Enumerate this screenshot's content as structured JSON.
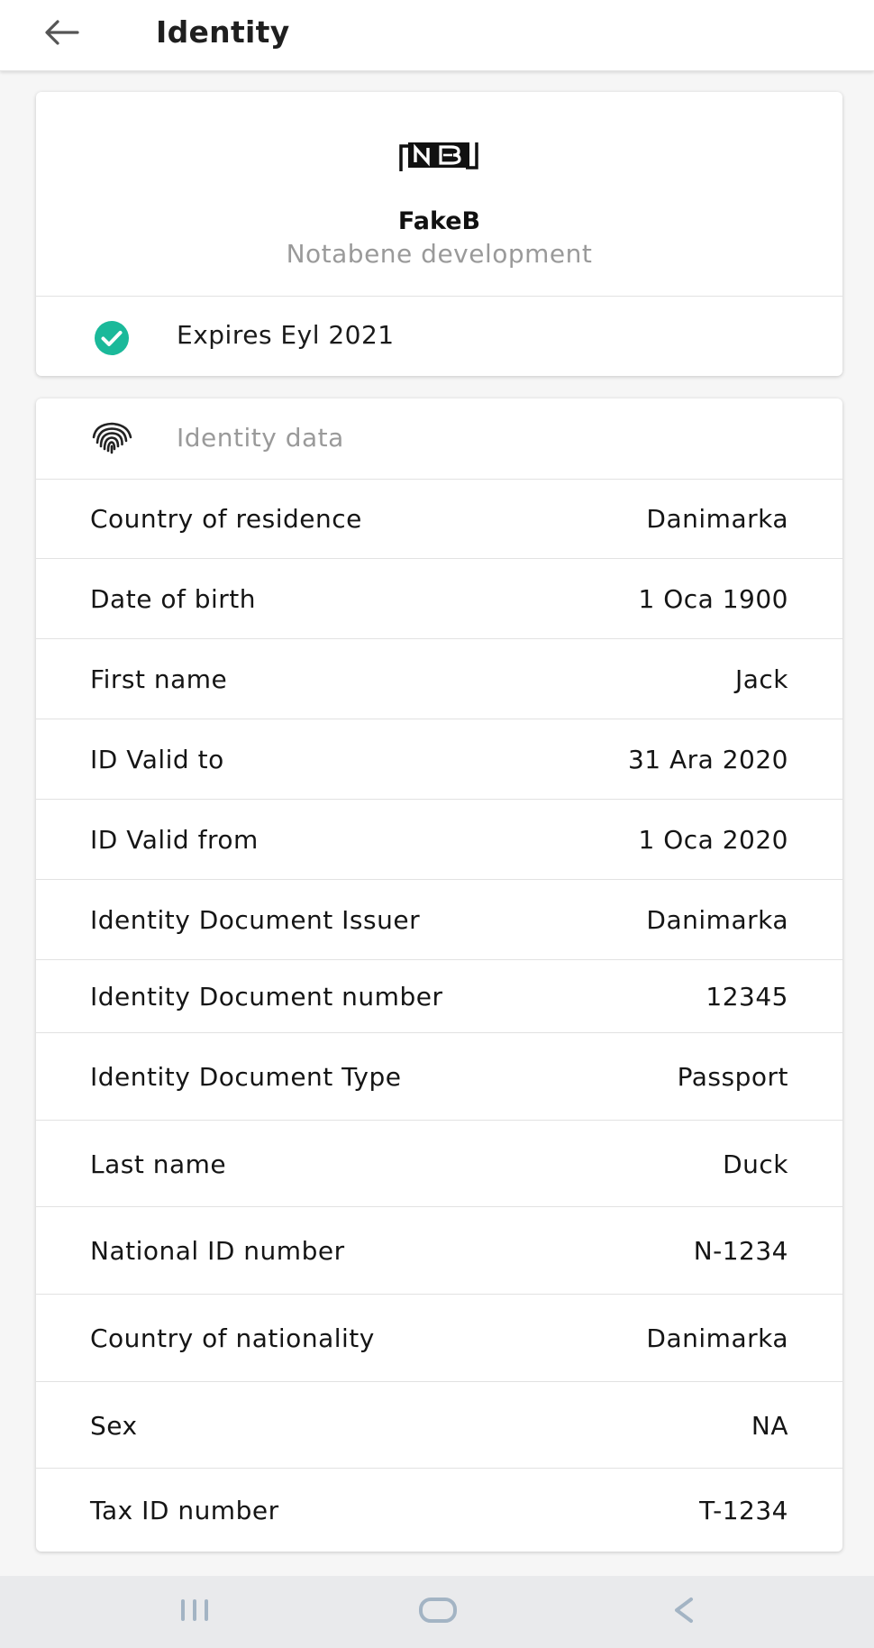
{
  "app_bar": {
    "title": "Identity",
    "back_icon": "arrow-left-icon"
  },
  "issuer": {
    "logo_text": "NB",
    "name": "FakeB",
    "organization": "Notabene development",
    "status_icon": "check-circle-icon",
    "status_color": "#1bb99a",
    "expires_label": "Expires Eyl 2021"
  },
  "identity_data": {
    "section_icon": "fingerprint-icon",
    "section_title": "Identity data",
    "rows": [
      {
        "label": "Country of residence",
        "value": "Danimarka"
      },
      {
        "label": "Date of birth",
        "value": "1 Oca 1900"
      },
      {
        "label": "First name",
        "value": "Jack"
      },
      {
        "label": "ID Valid to",
        "value": "31 Ara 2020"
      },
      {
        "label": "ID Valid from",
        "value": "1 Oca 2020"
      },
      {
        "label": "Identity Document Issuer",
        "value": "Danimarka"
      },
      {
        "label": "Identity Document number",
        "value": "12345"
      },
      {
        "label": "Identity Document Type",
        "value": "Passport"
      },
      {
        "label": "Last name",
        "value": "Duck"
      },
      {
        "label": "National ID number",
        "value": "N-1234"
      },
      {
        "label": "Country of nationality",
        "value": "Danimarka"
      },
      {
        "label": "Sex",
        "value": "NA"
      },
      {
        "label": "Tax ID number",
        "value": "T-1234"
      }
    ]
  },
  "nav_bar": {
    "recents_icon": "recents-icon",
    "home_icon": "home-icon",
    "back_icon": "chevron-left-icon"
  }
}
